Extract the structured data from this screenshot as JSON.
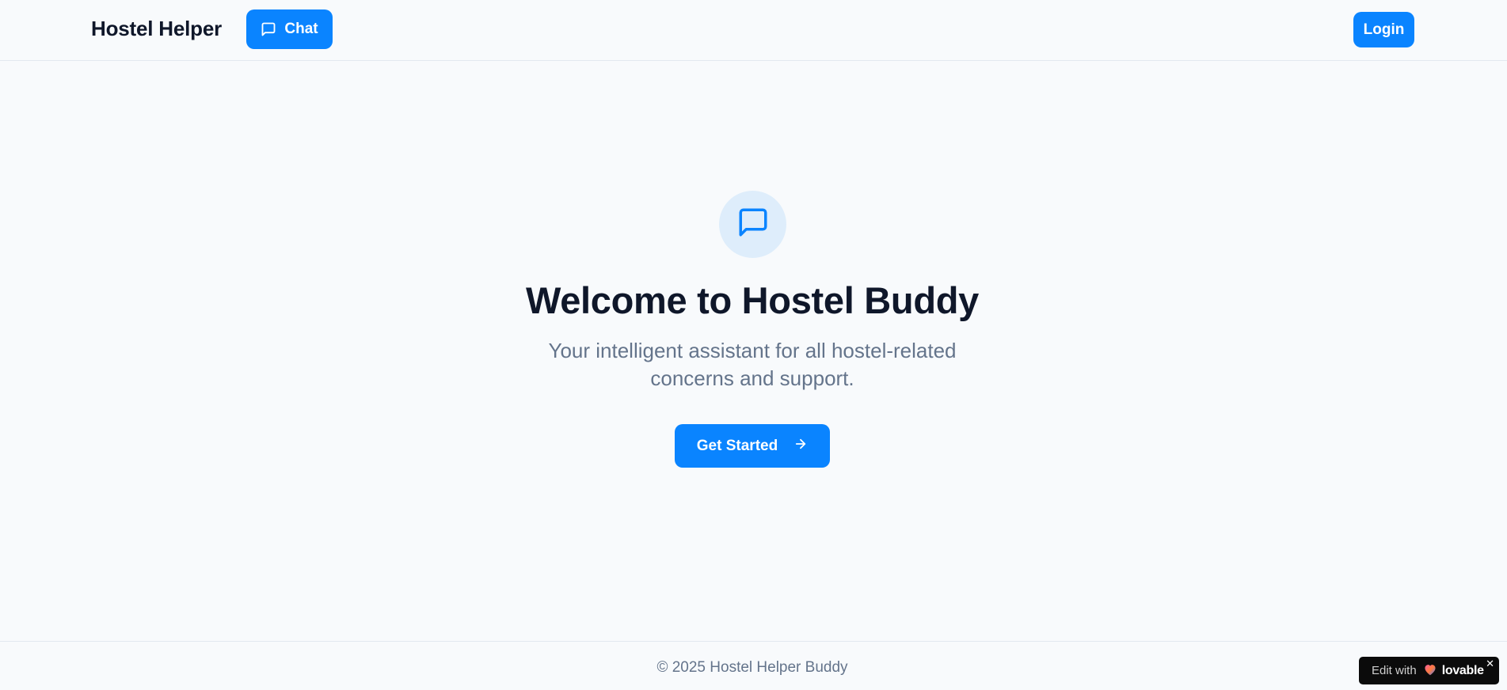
{
  "header": {
    "brand": "Hostel Helper",
    "chat_label": "Chat",
    "login_label": "Login"
  },
  "hero": {
    "icon": "message-square-icon",
    "title": "Welcome to Hostel Buddy",
    "subtitle": "Your intelligent assistant for all hostel-related concerns and support.",
    "cta_label": "Get Started",
    "cta_icon": "arrow-right-icon"
  },
  "footer": {
    "copyright": "© 2025 Hostel Helper Buddy"
  },
  "badge": {
    "prefix": "Edit with",
    "brand": "lovable",
    "close": "✕"
  },
  "colors": {
    "accent": "#0a84ff",
    "background": "#f8fafc",
    "heading": "#0f172a",
    "muted": "#64748b",
    "icon_circle": "#deedfb"
  }
}
